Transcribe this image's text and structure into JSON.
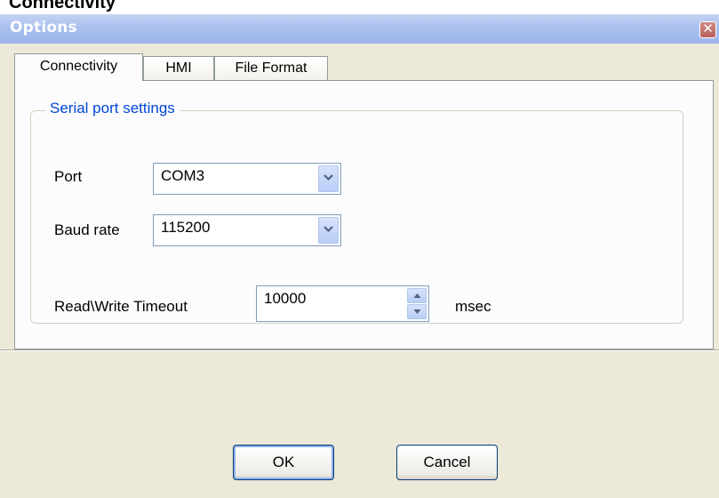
{
  "page_heading": "Connectivity",
  "window": {
    "title": "Options",
    "close_glyph": "✕",
    "close_icon": "close-icon"
  },
  "tabs": [
    {
      "label": "Connectivity",
      "active": true
    },
    {
      "label": "HMI",
      "active": false
    },
    {
      "label": "File Format",
      "active": false
    }
  ],
  "serial": {
    "group_title": "Serial port settings",
    "port_label": "Port",
    "port_value": "COM3",
    "baud_label": "Baud rate",
    "baud_value": "115200",
    "timeout_label": "Read\\Write Timeout",
    "timeout_value": "10000",
    "timeout_unit": "msec"
  },
  "buttons": {
    "ok": "OK",
    "cancel": "Cancel"
  },
  "colors": {
    "title_gradient": "#a9c0ef",
    "dialog_bg": "#ece9d8",
    "groupbox_title": "#0046d5",
    "input_border": "#7f9db9"
  }
}
